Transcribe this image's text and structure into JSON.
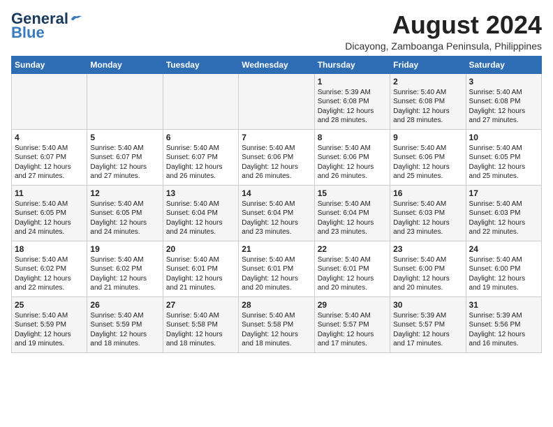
{
  "header": {
    "logo_general": "General",
    "logo_blue": "Blue",
    "month_title": "August 2024",
    "subtitle": "Dicayong, Zamboanga Peninsula, Philippines"
  },
  "weekdays": [
    "Sunday",
    "Monday",
    "Tuesday",
    "Wednesday",
    "Thursday",
    "Friday",
    "Saturday"
  ],
  "weeks": [
    [
      {
        "day": "",
        "info": ""
      },
      {
        "day": "",
        "info": ""
      },
      {
        "day": "",
        "info": ""
      },
      {
        "day": "",
        "info": ""
      },
      {
        "day": "1",
        "info": "Sunrise: 5:39 AM\nSunset: 6:08 PM\nDaylight: 12 hours\nand 28 minutes."
      },
      {
        "day": "2",
        "info": "Sunrise: 5:40 AM\nSunset: 6:08 PM\nDaylight: 12 hours\nand 28 minutes."
      },
      {
        "day": "3",
        "info": "Sunrise: 5:40 AM\nSunset: 6:08 PM\nDaylight: 12 hours\nand 27 minutes."
      }
    ],
    [
      {
        "day": "4",
        "info": "Sunrise: 5:40 AM\nSunset: 6:07 PM\nDaylight: 12 hours\nand 27 minutes."
      },
      {
        "day": "5",
        "info": "Sunrise: 5:40 AM\nSunset: 6:07 PM\nDaylight: 12 hours\nand 27 minutes."
      },
      {
        "day": "6",
        "info": "Sunrise: 5:40 AM\nSunset: 6:07 PM\nDaylight: 12 hours\nand 26 minutes."
      },
      {
        "day": "7",
        "info": "Sunrise: 5:40 AM\nSunset: 6:06 PM\nDaylight: 12 hours\nand 26 minutes."
      },
      {
        "day": "8",
        "info": "Sunrise: 5:40 AM\nSunset: 6:06 PM\nDaylight: 12 hours\nand 26 minutes."
      },
      {
        "day": "9",
        "info": "Sunrise: 5:40 AM\nSunset: 6:06 PM\nDaylight: 12 hours\nand 25 minutes."
      },
      {
        "day": "10",
        "info": "Sunrise: 5:40 AM\nSunset: 6:05 PM\nDaylight: 12 hours\nand 25 minutes."
      }
    ],
    [
      {
        "day": "11",
        "info": "Sunrise: 5:40 AM\nSunset: 6:05 PM\nDaylight: 12 hours\nand 24 minutes."
      },
      {
        "day": "12",
        "info": "Sunrise: 5:40 AM\nSunset: 6:05 PM\nDaylight: 12 hours\nand 24 minutes."
      },
      {
        "day": "13",
        "info": "Sunrise: 5:40 AM\nSunset: 6:04 PM\nDaylight: 12 hours\nand 24 minutes."
      },
      {
        "day": "14",
        "info": "Sunrise: 5:40 AM\nSunset: 6:04 PM\nDaylight: 12 hours\nand 23 minutes."
      },
      {
        "day": "15",
        "info": "Sunrise: 5:40 AM\nSunset: 6:04 PM\nDaylight: 12 hours\nand 23 minutes."
      },
      {
        "day": "16",
        "info": "Sunrise: 5:40 AM\nSunset: 6:03 PM\nDaylight: 12 hours\nand 23 minutes."
      },
      {
        "day": "17",
        "info": "Sunrise: 5:40 AM\nSunset: 6:03 PM\nDaylight: 12 hours\nand 22 minutes."
      }
    ],
    [
      {
        "day": "18",
        "info": "Sunrise: 5:40 AM\nSunset: 6:02 PM\nDaylight: 12 hours\nand 22 minutes."
      },
      {
        "day": "19",
        "info": "Sunrise: 5:40 AM\nSunset: 6:02 PM\nDaylight: 12 hours\nand 21 minutes."
      },
      {
        "day": "20",
        "info": "Sunrise: 5:40 AM\nSunset: 6:01 PM\nDaylight: 12 hours\nand 21 minutes."
      },
      {
        "day": "21",
        "info": "Sunrise: 5:40 AM\nSunset: 6:01 PM\nDaylight: 12 hours\nand 20 minutes."
      },
      {
        "day": "22",
        "info": "Sunrise: 5:40 AM\nSunset: 6:01 PM\nDaylight: 12 hours\nand 20 minutes."
      },
      {
        "day": "23",
        "info": "Sunrise: 5:40 AM\nSunset: 6:00 PM\nDaylight: 12 hours\nand 20 minutes."
      },
      {
        "day": "24",
        "info": "Sunrise: 5:40 AM\nSunset: 6:00 PM\nDaylight: 12 hours\nand 19 minutes."
      }
    ],
    [
      {
        "day": "25",
        "info": "Sunrise: 5:40 AM\nSunset: 5:59 PM\nDaylight: 12 hours\nand 19 minutes."
      },
      {
        "day": "26",
        "info": "Sunrise: 5:40 AM\nSunset: 5:59 PM\nDaylight: 12 hours\nand 18 minutes."
      },
      {
        "day": "27",
        "info": "Sunrise: 5:40 AM\nSunset: 5:58 PM\nDaylight: 12 hours\nand 18 minutes."
      },
      {
        "day": "28",
        "info": "Sunrise: 5:40 AM\nSunset: 5:58 PM\nDaylight: 12 hours\nand 18 minutes."
      },
      {
        "day": "29",
        "info": "Sunrise: 5:40 AM\nSunset: 5:57 PM\nDaylight: 12 hours\nand 17 minutes."
      },
      {
        "day": "30",
        "info": "Sunrise: 5:39 AM\nSunset: 5:57 PM\nDaylight: 12 hours\nand 17 minutes."
      },
      {
        "day": "31",
        "info": "Sunrise: 5:39 AM\nSunset: 5:56 PM\nDaylight: 12 hours\nand 16 minutes."
      }
    ]
  ]
}
